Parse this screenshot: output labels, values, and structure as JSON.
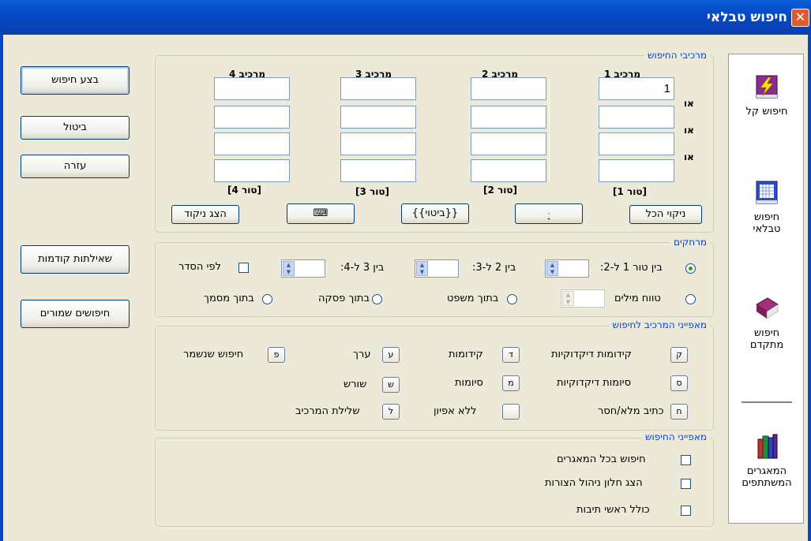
{
  "window": {
    "title": "חיפוש טבלאי",
    "close_glyph": "✕"
  },
  "left_buttons": {
    "search": "בצע חיפוש",
    "cancel": "ביטול",
    "help": "עזרה",
    "previous_queries": "שאילתות קודמות",
    "saved_searches": "חיפושים שמורים"
  },
  "components_group": {
    "title": "מרכיבי החיפוש",
    "columns": [
      {
        "header": "מרכיב 1",
        "footer": "[טור 1]",
        "values": [
          "1",
          "",
          "",
          ""
        ]
      },
      {
        "header": "מרכיב 2",
        "footer": "[טור 2]",
        "values": [
          "",
          "",
          "",
          ""
        ]
      },
      {
        "header": "מרכיב 3",
        "footer": "[טור 3]",
        "values": [
          "",
          "",
          "",
          ""
        ]
      },
      {
        "header": "מרכיב 4",
        "footer": "[טור 4]",
        "values": [
          "",
          "",
          "",
          ""
        ]
      }
    ],
    "or_labels": [
      "או",
      "או",
      "או"
    ],
    "buttons": {
      "clear_all": "ניקוי הכל",
      "vowels": "ּ֑",
      "expression": "{{ביטוי}}",
      "keyboard": "⌨",
      "show_vowels": "הצג ניקוד"
    }
  },
  "distances_group": {
    "title": "מרחקים",
    "between_1_2": "בין טור 1 ל-2:",
    "between_2_3": "בין 2 ל-3:",
    "between_3_4": "בין 3 ל-4:",
    "in_order": "לפי הסדר",
    "word_range": "טווח מילים",
    "in_sentence": "בתוך משפט",
    "in_paragraph": "בתוך פסקה",
    "in_document": "בתוך מסמך",
    "selected": "between"
  },
  "features_group": {
    "title": "מאפייני המרכיב לחיפוש",
    "items": [
      {
        "key": "ק",
        "label": "קידומות דיקדוקיות"
      },
      {
        "key": "ד",
        "label": "קידומות"
      },
      {
        "key": "ע",
        "label": "ערך"
      },
      {
        "key": "פ",
        "label": "חיפוש שנשמר"
      },
      {
        "key": "ס",
        "label": "סיומות דיקדוקיות"
      },
      {
        "key": "מ",
        "label": "סיומות"
      },
      {
        "key": "ש",
        "label": "שורש"
      },
      {
        "key": "ח",
        "label": "כתיב מלא/חסר"
      },
      {
        "key": "",
        "label": "ללא אפיון"
      },
      {
        "key": "ל",
        "label": "שלילת המרכיב"
      }
    ]
  },
  "search_features_group": {
    "title": "מאפייני החיפוש",
    "options": [
      "חיפוש בכל המאגרים",
      "הצג חלון ניהול הצורות",
      "כולל ראשי תיבות"
    ]
  },
  "sidebar": {
    "items": [
      "חיפוש קל",
      "חיפוש טבלאי",
      "חיפוש מתקדם",
      "המאגרים המשתתפים"
    ]
  }
}
